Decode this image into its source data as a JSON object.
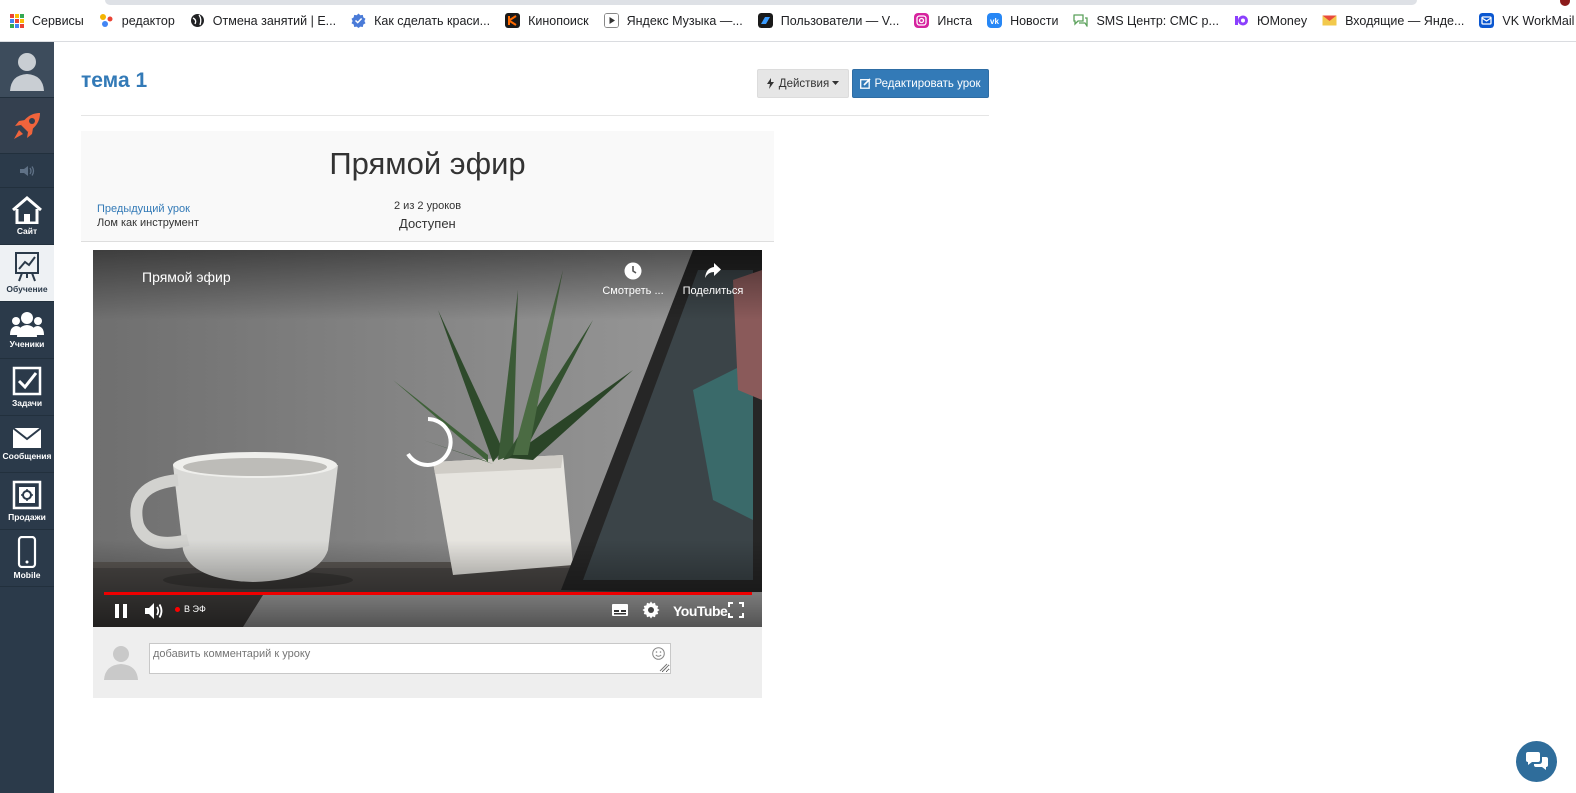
{
  "bookmarks": {
    "items": [
      {
        "label": "Сервисы",
        "icon": "apps-grid-icon"
      },
      {
        "label": "редактор",
        "icon": "dots-icon",
        "color": "#f4b400"
      },
      {
        "label": "Отмена занятий | E...",
        "icon": "globe-icon",
        "color": "#202124"
      },
      {
        "label": "Как сделать краси...",
        "icon": "verified-icon",
        "color": "#4a7bd8"
      },
      {
        "label": "Кинопоиск",
        "icon": "kinopoisk-icon",
        "color": "#1a1a1a"
      },
      {
        "label": "Яндекс Музыка —...",
        "icon": "play-icon",
        "color": "#333333"
      },
      {
        "label": "Пользователи — V...",
        "icon": "v-icon",
        "color": "#1a1a1a"
      },
      {
        "label": "Инста",
        "icon": "instagram-icon",
        "color": "#d6249f"
      },
      {
        "label": "Новости",
        "icon": "vk-icon",
        "color": "#2787f5"
      },
      {
        "label": "SMS Центр: СМС р...",
        "icon": "chat-icon",
        "color": "#5aa05a"
      },
      {
        "label": "ЮMoney",
        "icon": "yumoney-icon",
        "color": "#8b3ffd"
      },
      {
        "label": "Входящие — Янде...",
        "icon": "mail-icon",
        "color": "#e84a3c"
      },
      {
        "label": "VK WorkMail",
        "icon": "workmail-icon",
        "color": "#0b57d0"
      }
    ]
  },
  "sidebar": {
    "items": [
      {
        "label": "Сайт",
        "icon": "home-icon"
      },
      {
        "label": "Обучение",
        "icon": "chart-board-icon"
      },
      {
        "label": "Ученики",
        "icon": "users-icon"
      },
      {
        "label": "Задачи",
        "icon": "checkbox-icon"
      },
      {
        "label": "Сообщения",
        "icon": "envelope-icon"
      },
      {
        "label": "Продажи",
        "icon": "safe-icon"
      },
      {
        "label": "Mobile",
        "icon": "phone-icon"
      }
    ],
    "active": "Обучение",
    "accent_color": "#f0643c"
  },
  "header": {
    "title": "тема 1",
    "actions_label": "Действия",
    "edit_label": "Редактировать урок"
  },
  "lesson": {
    "title": "Прямой эфир",
    "prev_link": "Предыдущий урок",
    "prev_name": "Лом как инструмент",
    "count": "2 из 2 уроков",
    "status": "Доступен"
  },
  "video": {
    "title": "Прямой эфир",
    "watch_later": "Смотреть ...",
    "share": "Поделиться",
    "live": "В ЭФ",
    "brand": "YouTube",
    "progress_color": "#ee0000"
  },
  "comment": {
    "placeholder": "добавить комментарий к уроку"
  },
  "colors": {
    "link": "#337ab7",
    "sidebar": "#2b3a4a"
  }
}
